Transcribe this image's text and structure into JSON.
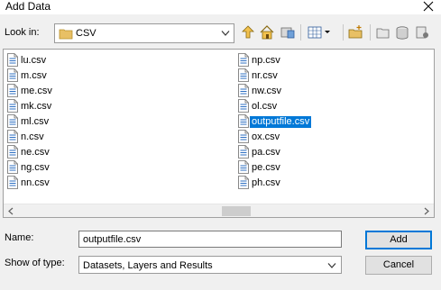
{
  "window": {
    "title": "Add Data"
  },
  "look_in": {
    "label": "Look in:",
    "value": "CSV"
  },
  "files": {
    "column1": [
      "lu.csv",
      "m.csv",
      "me.csv",
      "mk.csv",
      "ml.csv",
      "n.csv",
      "ne.csv",
      "ng.csv",
      "nn.csv"
    ],
    "column2": [
      "np.csv",
      "nr.csv",
      "nw.csv",
      "ol.csv",
      "outputfile.csv",
      "ox.csv",
      "pa.csv",
      "pe.csv",
      "ph.csv"
    ],
    "selected": "outputfile.csv"
  },
  "name": {
    "label": "Name:",
    "value": "outputfile.csv"
  },
  "show_of_type": {
    "label": "Show of type:",
    "value": "Datasets, Layers and Results"
  },
  "buttons": {
    "add": "Add",
    "cancel": "Cancel"
  },
  "colors": {
    "selection": "#0078d7",
    "folder": "#e8c065"
  }
}
